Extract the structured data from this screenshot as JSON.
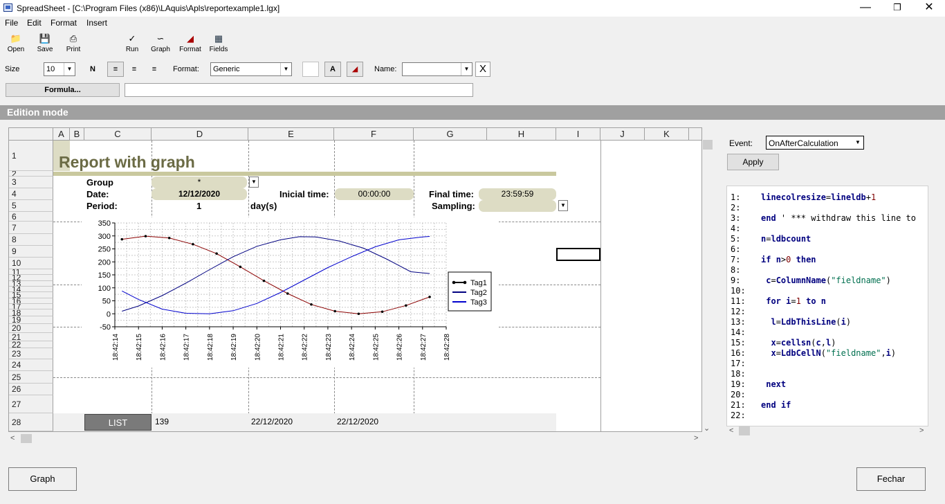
{
  "window": {
    "title": "SpreadSheet - [C:\\Program Files (x86)\\LAquis\\Apls\\reportexample1.lgx]"
  },
  "menu": [
    {
      "label": "File",
      "ul": "F"
    },
    {
      "label": "Edit",
      "ul": "E"
    },
    {
      "label": "Format",
      "ul": "F"
    },
    {
      "label": "Insert",
      "ul": "I"
    }
  ],
  "toolbar": {
    "open": "Open",
    "save": "Save",
    "print": "Print",
    "run": "Run",
    "graph": "Graph",
    "format": "Format",
    "fields": "Fields"
  },
  "fmt": {
    "size_label": "Size",
    "size_value": "10",
    "bold": "N",
    "format_label": "Format:",
    "format_value": "Generic",
    "font_btn": "A",
    "name_label": "Name:",
    "name_value": "",
    "close": "X"
  },
  "formula": {
    "button": "Formula...",
    "value": ""
  },
  "mode": "Edition mode",
  "grid": {
    "columns": [
      "A",
      "B",
      "C",
      "D",
      "E",
      "F",
      "G",
      "H",
      "I",
      "J",
      "K"
    ],
    "rows": [
      "1",
      "2",
      "3",
      "4",
      "5",
      "6",
      "7",
      "8",
      "9",
      "10",
      "11",
      "12",
      "13",
      "14",
      "15",
      "16",
      "17",
      "18",
      "19",
      "20",
      "21",
      "22",
      "23",
      "24",
      "25",
      "26",
      "27",
      "28"
    ],
    "title": "Report with graph",
    "group_label": "Group",
    "group_value": "*",
    "date_label": "Date:",
    "date_value": "12/12/2020",
    "period_label": "Period:",
    "period_value": "1",
    "period_unit": "day(s)",
    "inicial_label": "Inicial time:",
    "inicial_value": "00:00:00",
    "final_label": "Final time:",
    "final_value": "23:59:59",
    "sampling_label": "Sampling:",
    "sampling_value": "",
    "list_button": "LIST",
    "list_count": "139",
    "list_date1": "22/12/2020",
    "list_date2": "22/12/2020"
  },
  "chart_data": {
    "type": "line",
    "x": [
      "18:42:14",
      "18:42:15",
      "18:42:16",
      "18:42:17",
      "18:42:18",
      "18:42:19",
      "18:42:20",
      "18:42:21",
      "18:42:22",
      "18:42:23",
      "18:42:24",
      "18:42:25",
      "18:42:26",
      "18:42:27",
      "18:42:28"
    ],
    "ylim": [
      -50,
      350
    ],
    "yticks": [
      "350",
      "300",
      "250",
      "200",
      "150",
      "100",
      "50",
      "0",
      "-50"
    ],
    "grid": true,
    "legend": "right",
    "series": [
      {
        "name": "Tag1",
        "color": "#8b0000",
        "marker": true,
        "points": [
          [
            0.3,
            287
          ],
          [
            1.3,
            299
          ],
          [
            2.3,
            292
          ],
          [
            3.3,
            268
          ],
          [
            4.3,
            232
          ],
          [
            5.3,
            181
          ],
          [
            6.3,
            127
          ],
          [
            7.3,
            78
          ],
          [
            8.3,
            36
          ],
          [
            9.3,
            10
          ],
          [
            10.3,
            0
          ],
          [
            11.3,
            8
          ],
          [
            12.3,
            32
          ],
          [
            13.3,
            65
          ]
        ]
      },
      {
        "name": "Tag2",
        "color": "#000080",
        "marker": false,
        "points": [
          [
            0.3,
            10
          ],
          [
            1,
            30
          ],
          [
            2,
            70
          ],
          [
            3,
            118
          ],
          [
            4,
            170
          ],
          [
            5,
            220
          ],
          [
            6,
            260
          ],
          [
            7,
            285
          ],
          [
            7.8,
            297
          ],
          [
            8.5,
            296
          ],
          [
            9.5,
            280
          ],
          [
            10.5,
            253
          ],
          [
            11.5,
            210
          ],
          [
            12.5,
            162
          ],
          [
            13.3,
            155
          ]
        ]
      },
      {
        "name": "Tag3",
        "color": "#0000cd",
        "marker": false,
        "points": [
          [
            0.3,
            88
          ],
          [
            1,
            55
          ],
          [
            2,
            18
          ],
          [
            3,
            2
          ],
          [
            4,
            0
          ],
          [
            5,
            12
          ],
          [
            6,
            40
          ],
          [
            7,
            82
          ],
          [
            8,
            130
          ],
          [
            9,
            178
          ],
          [
            10,
            220
          ],
          [
            11,
            258
          ],
          [
            12,
            285
          ],
          [
            13,
            296
          ],
          [
            13.3,
            298
          ]
        ]
      }
    ]
  },
  "event": {
    "label": "Event:",
    "value": "OnAfterCalculation",
    "apply": "Apply"
  },
  "code": [
    {
      "n": "1:",
      "t": "linecolresize=lineldb+1"
    },
    {
      "n": "2:",
      "t": ""
    },
    {
      "n": "3:",
      "t": "end ' *** withdraw this line to"
    },
    {
      "n": "4:",
      "t": ""
    },
    {
      "n": "5:",
      "t": "n=ldbcount"
    },
    {
      "n": "6:",
      "t": ""
    },
    {
      "n": "7:",
      "t": "if n>0 then"
    },
    {
      "n": "8:",
      "t": ""
    },
    {
      "n": "9:",
      "t": " c=ColumnName(\"fieldname\")"
    },
    {
      "n": "10:",
      "t": ""
    },
    {
      "n": "11:",
      "t": " for i=1 to n"
    },
    {
      "n": "12:",
      "t": ""
    },
    {
      "n": "13:",
      "t": "  l=LdbThisLine(i)"
    },
    {
      "n": "14:",
      "t": ""
    },
    {
      "n": "15:",
      "t": "  x=cellsn(c,l)"
    },
    {
      "n": "16:",
      "t": "  x=LdbCellN(\"fieldname\",i)"
    },
    {
      "n": "17:",
      "t": ""
    },
    {
      "n": "18:",
      "t": ""
    },
    {
      "n": "19:",
      "t": " next"
    },
    {
      "n": "20:",
      "t": ""
    },
    {
      "n": "21:",
      "t": "end if"
    },
    {
      "n": "22:",
      "t": ""
    }
  ],
  "buttons": {
    "graph": "Graph",
    "close": "Fechar"
  }
}
